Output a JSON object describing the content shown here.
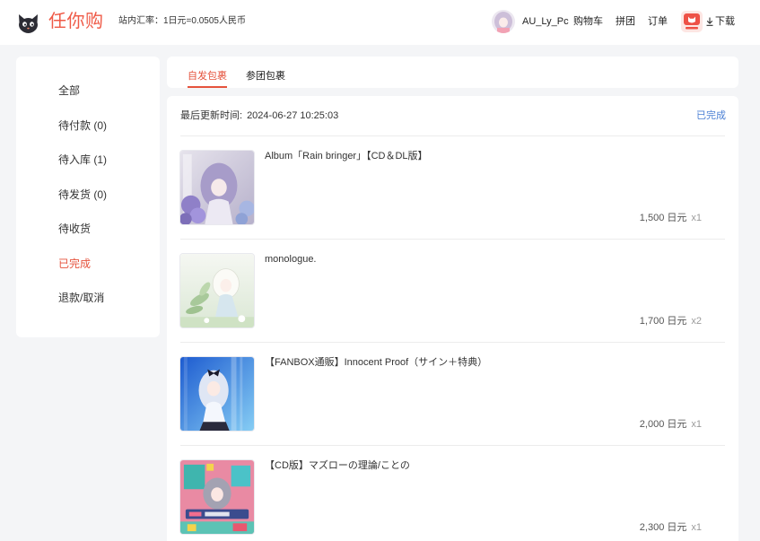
{
  "colors": {
    "brand": "#ef5a47",
    "active": "#e5533d",
    "status": "#4a7fd4",
    "background": "#f4f5f7"
  },
  "header": {
    "brand": "任你购",
    "logo_icon": "cat-logo-icon",
    "exchange_rate": "站内汇率：1日元=0.0505人民币",
    "username": "AU_Ly_Pc",
    "nav": [
      {
        "label": "购物车"
      },
      {
        "label": "拼团"
      },
      {
        "label": "订单"
      }
    ],
    "app_icon": "app-icon",
    "download": {
      "icon": "download-icon",
      "label": "下载"
    }
  },
  "sidebar": {
    "items": [
      {
        "label": "全部",
        "active": false
      },
      {
        "label": "待付款 (0)",
        "active": false
      },
      {
        "label": "待入库 (1)",
        "active": false
      },
      {
        "label": "待发货 (0)",
        "active": false
      },
      {
        "label": "待收货",
        "active": false
      },
      {
        "label": "已完成",
        "active": true
      },
      {
        "label": "退款/取消",
        "active": false
      }
    ]
  },
  "tabs": [
    {
      "label": "自发包裹",
      "active": true
    },
    {
      "label": "参团包裹",
      "active": false
    }
  ],
  "order": {
    "updated_label": "最后更新时间:",
    "updated_at": "2024-06-27 10:25:03",
    "status": "已完成",
    "items": [
      {
        "title": "Album「Rain bringer」【CD＆DL版】",
        "price": "1,500 日元",
        "quantity": "x1"
      },
      {
        "title": "monologue.",
        "price": "1,700 日元",
        "quantity": "x2"
      },
      {
        "title": "【FANBOX通販】Innocent Proof（サイン＋特典）",
        "price": "2,000 日元",
        "quantity": "x1"
      },
      {
        "title": "【CD版】マズローの理論/ことの",
        "price": "2,300 日元",
        "quantity": "x1"
      }
    ]
  }
}
